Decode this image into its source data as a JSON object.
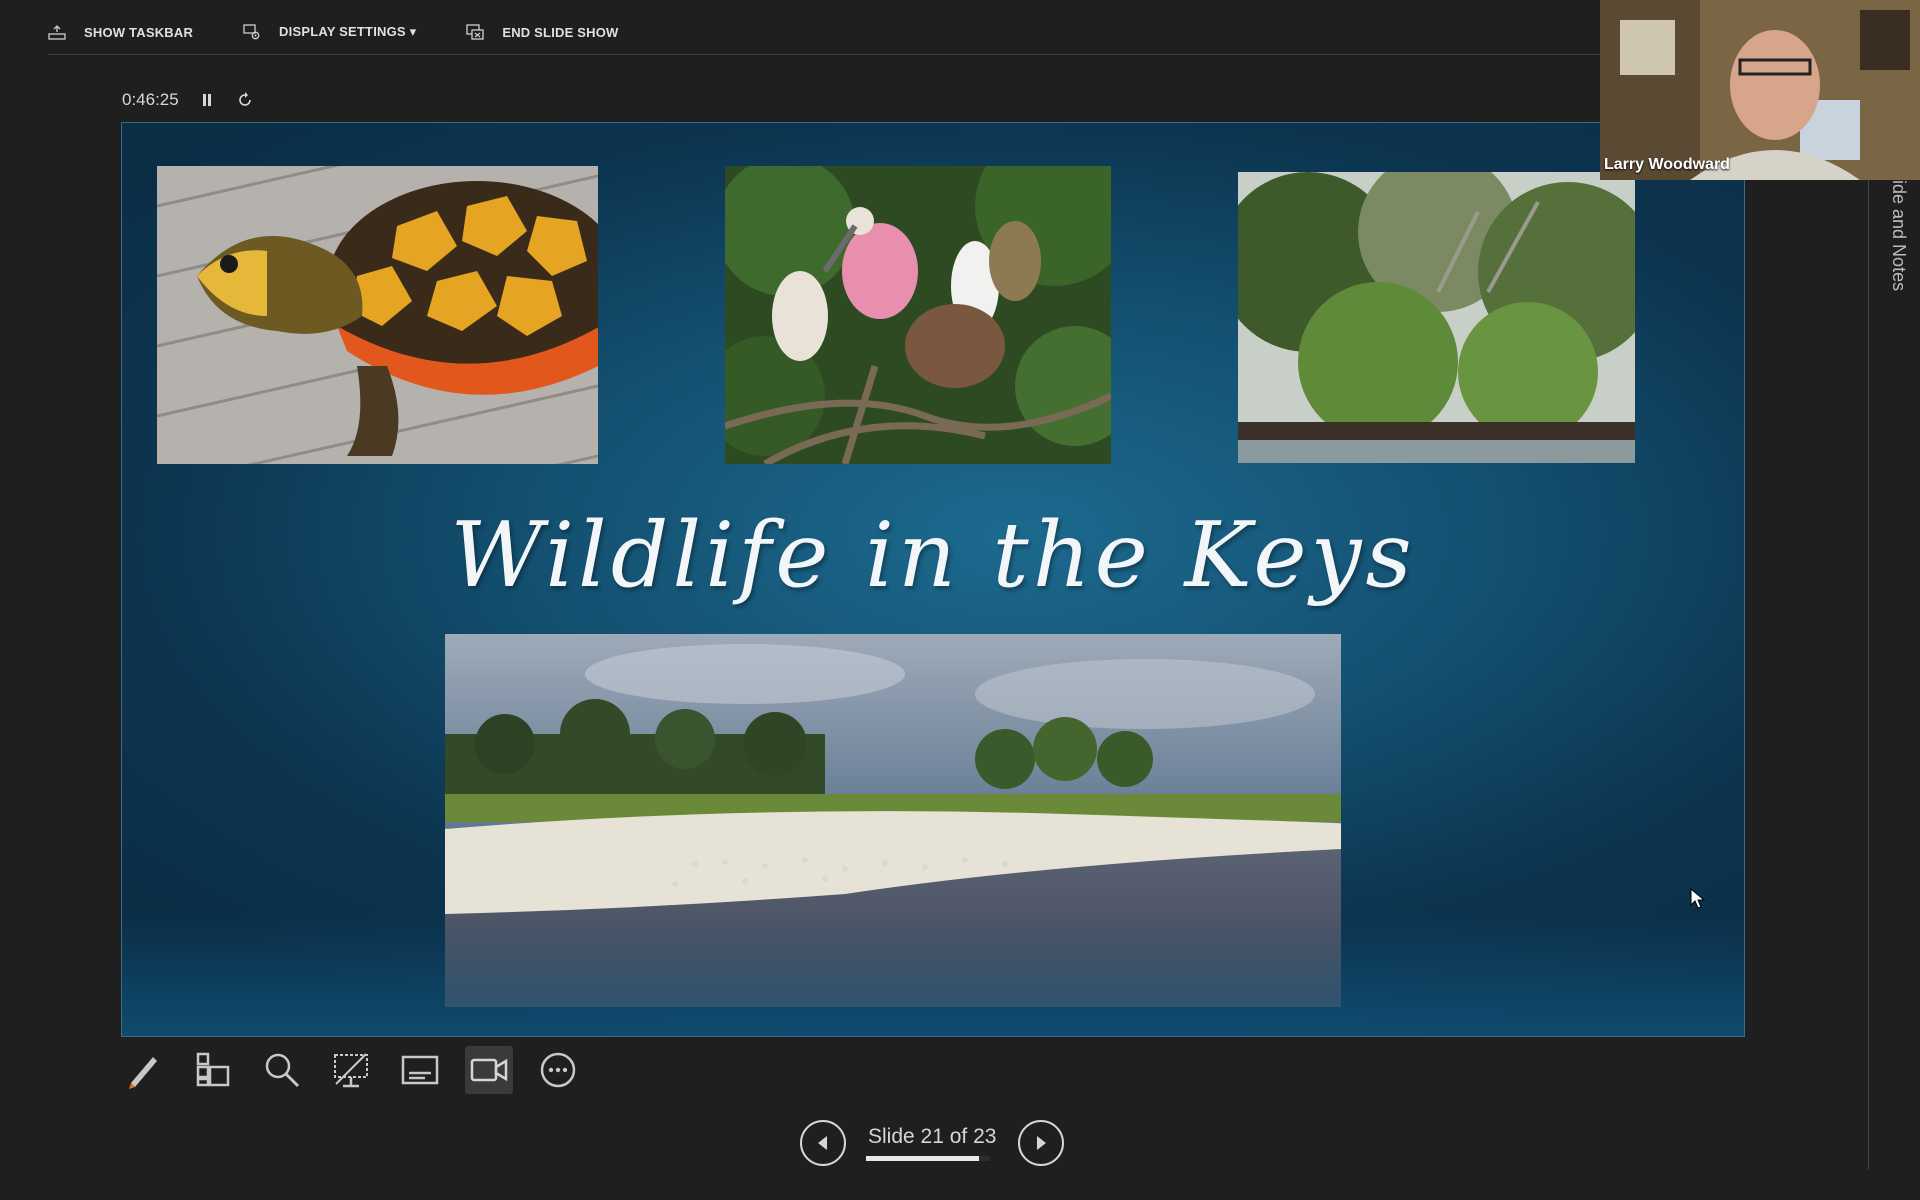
{
  "toolbar": {
    "show_taskbar": "SHOW TASKBAR",
    "display_settings": "DISPLAY SETTINGS ▾",
    "end_slide_show": "END SLIDE SHOW"
  },
  "timer": {
    "elapsed": "0:46:25"
  },
  "slide": {
    "title": "Wildlife in the Keys"
  },
  "notes_pane": {
    "label": "ide and Notes"
  },
  "video": {
    "participant_name": "Larry Woodward"
  },
  "navigation": {
    "slide_counter": "Slide 21 of 23",
    "progress": 0.913
  },
  "icons": [
    "taskbar-icon",
    "display-settings-icon",
    "end-show-icon",
    "pause-icon",
    "reset-icon",
    "pen-icon",
    "see-all-slides-icon",
    "zoom-icon",
    "black-screen-icon",
    "subtitles-icon",
    "camera-icon",
    "more-options-icon",
    "previous-icon",
    "next-icon"
  ]
}
